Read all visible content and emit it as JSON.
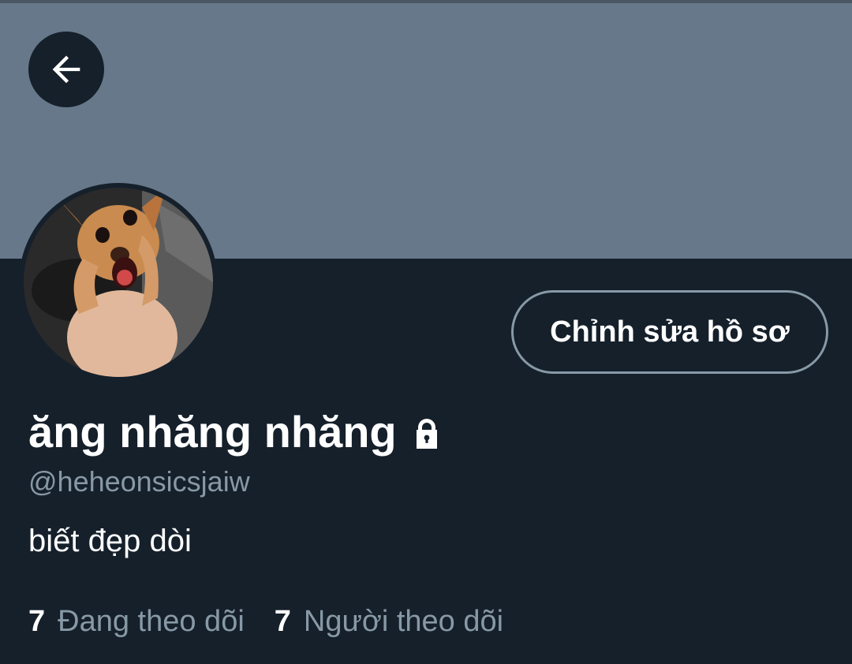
{
  "header": {
    "back_icon": "arrow-left-icon"
  },
  "profile": {
    "avatar_description": "avatar",
    "display_name": "ăng nhăng nhăng",
    "protected_icon": "lock-icon",
    "handle": "@heheonsicsjaiw",
    "bio": "biết đẹp dòi",
    "edit_button_label": "Chỉnh sửa hồ sơ"
  },
  "stats": {
    "following_count": "7",
    "following_label": "Đang theo dõi",
    "followers_count": "7",
    "followers_label": "Người theo dõi"
  },
  "colors": {
    "banner": "#66788a",
    "background": "#15202b",
    "secondary_text": "#8899a6",
    "primary_text": "#ffffff"
  }
}
